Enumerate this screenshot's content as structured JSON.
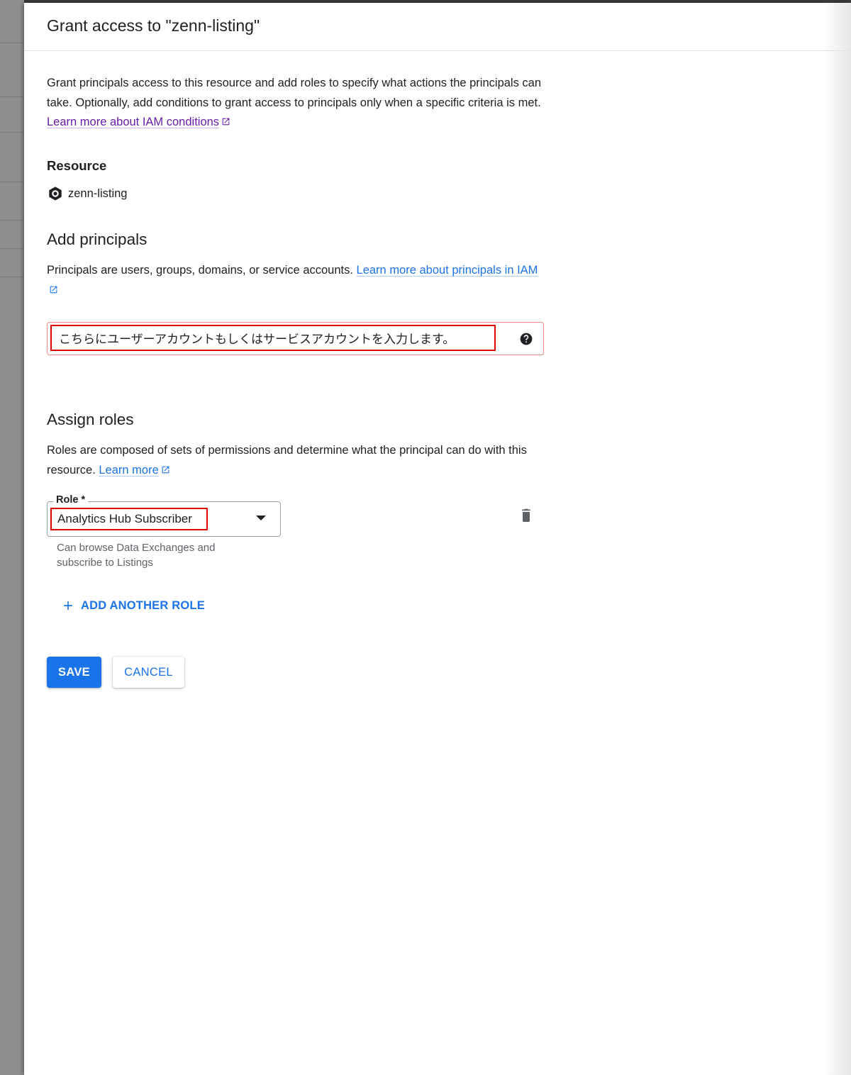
{
  "dialog": {
    "title": "Grant access to \"zenn-listing\""
  },
  "intro": {
    "text": "Grant principals access to this resource and add roles to specify what actions the principals can take. Optionally, add conditions to grant access to principals only when a specific criteria is met. ",
    "link": "Learn more about IAM conditions"
  },
  "resource": {
    "label": "Resource",
    "name": "zenn-listing"
  },
  "principals": {
    "heading": "Add principals",
    "text": "Principals are users, groups, domains, or service accounts. ",
    "link": "Learn more about principals in IAM",
    "input_value": "こちらにユーザーアカウントもしくはサービスアカウントを入力します。"
  },
  "roles": {
    "heading": "Assign roles",
    "text": "Roles are composed of sets of permissions and determine what the principal can do with this resource. ",
    "link": "Learn more",
    "field_label": "Role *",
    "selected": "Analytics Hub Subscriber",
    "hint": "Can browse Data Exchanges and subscribe to Listings",
    "add_label": "ADD ANOTHER ROLE"
  },
  "actions": {
    "save": "SAVE",
    "cancel": "CANCEL"
  },
  "colors": {
    "accent": "#1a73e8",
    "visited_link": "#681da8",
    "highlight_box": "#e00000",
    "error_border": "#f28b82"
  }
}
